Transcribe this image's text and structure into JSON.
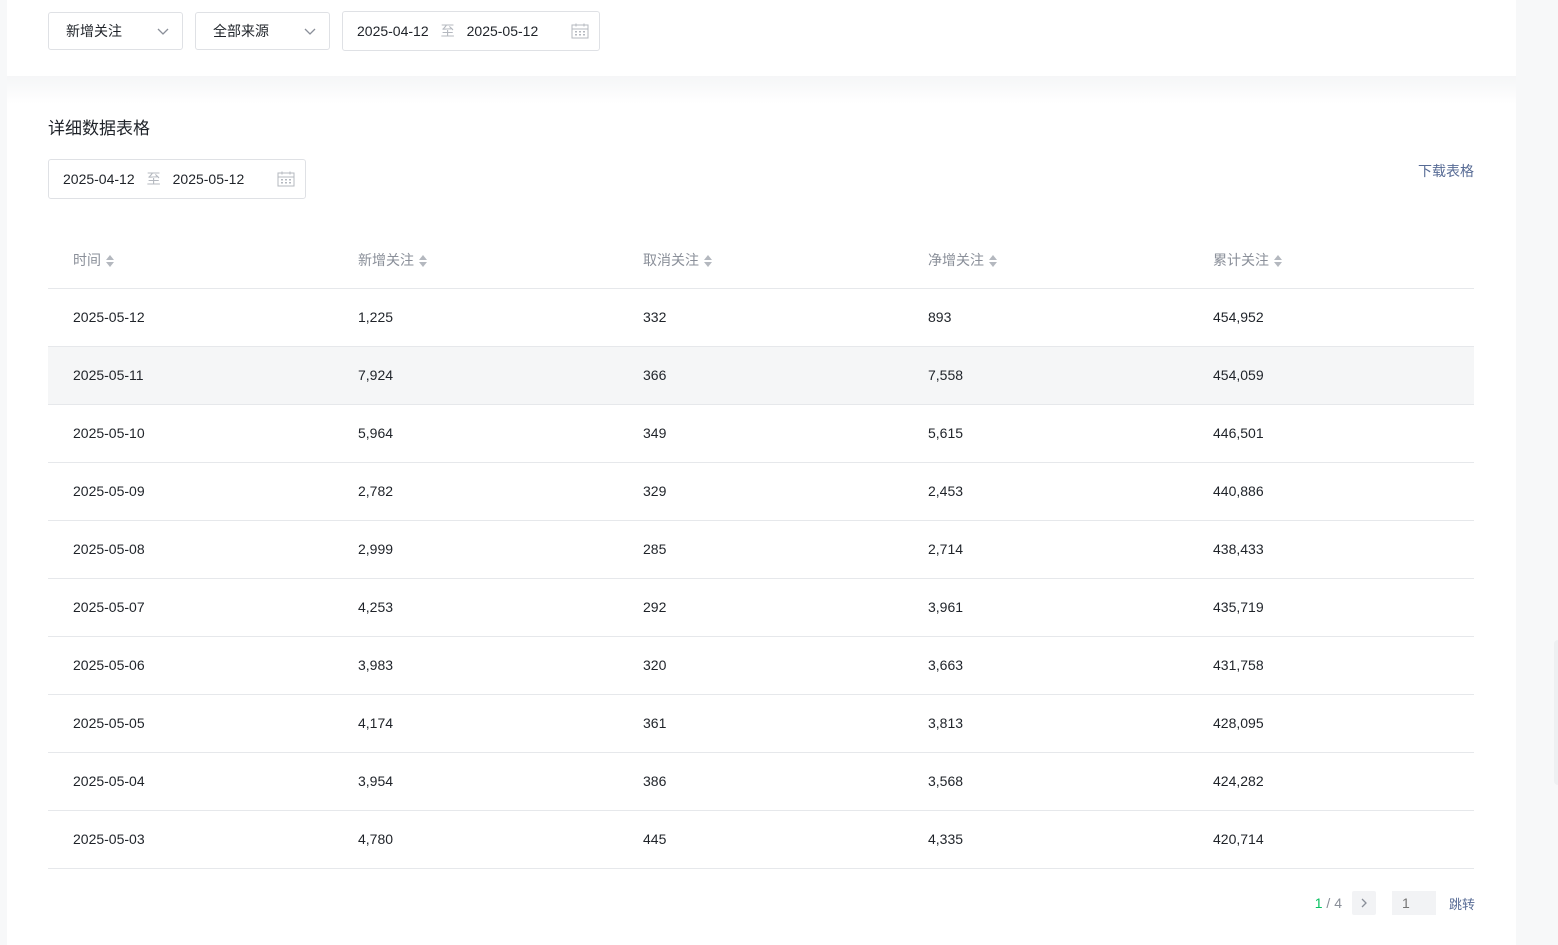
{
  "filters": {
    "metric_select": "新增关注",
    "source_select": "全部来源",
    "date_range": {
      "start": "2025-04-12",
      "separator": "至",
      "end": "2025-05-12"
    }
  },
  "detail": {
    "title": "详细数据表格",
    "date_range": {
      "start": "2025-04-12",
      "separator": "至",
      "end": "2025-05-12"
    },
    "download_label": "下载表格",
    "columns": [
      "时间",
      "新增关注",
      "取消关注",
      "净增关注",
      "累计关注"
    ],
    "rows": [
      [
        "2025-05-12",
        "1,225",
        "332",
        "893",
        "454,952"
      ],
      [
        "2025-05-11",
        "7,924",
        "366",
        "7,558",
        "454,059"
      ],
      [
        "2025-05-10",
        "5,964",
        "349",
        "5,615",
        "446,501"
      ],
      [
        "2025-05-09",
        "2,782",
        "329",
        "2,453",
        "440,886"
      ],
      [
        "2025-05-08",
        "2,999",
        "285",
        "2,714",
        "438,433"
      ],
      [
        "2025-05-07",
        "4,253",
        "292",
        "3,961",
        "435,719"
      ],
      [
        "2025-05-06",
        "3,983",
        "320",
        "3,663",
        "431,758"
      ],
      [
        "2025-05-05",
        "4,174",
        "361",
        "3,813",
        "428,095"
      ],
      [
        "2025-05-04",
        "3,954",
        "386",
        "3,568",
        "424,282"
      ],
      [
        "2025-05-03",
        "4,780",
        "445",
        "4,335",
        "420,714"
      ]
    ]
  },
  "pagination": {
    "current": "1",
    "separator": " / ",
    "total": "4",
    "page_input_placeholder": "1",
    "jump_label": "跳转"
  },
  "icons": {
    "chevron": "chevron-down-icon",
    "calendar": "calendar-icon",
    "sort": "sort-icon",
    "next": "chevron-right-icon"
  },
  "colors": {
    "accent_green": "#07c160",
    "link_blue": "#576b95",
    "muted": "#8a8f99",
    "row_highlight": "#f5f6f7"
  }
}
